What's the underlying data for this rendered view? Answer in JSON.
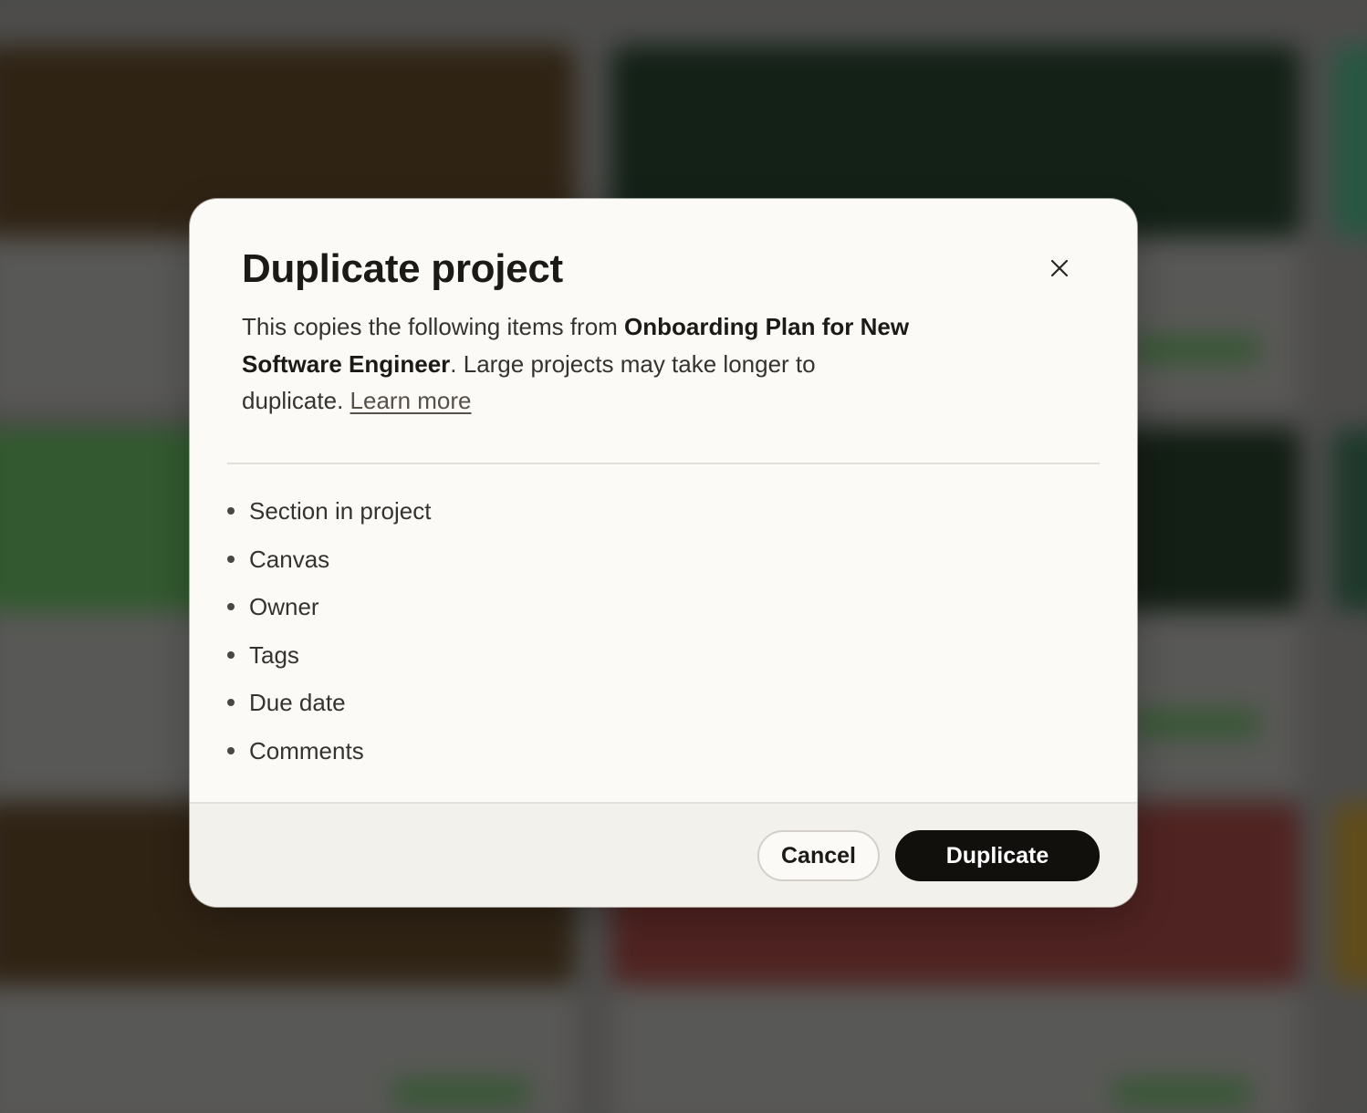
{
  "colors": {
    "modal_bg": "#fbfaf7",
    "footer_bg": "#f3f1ec",
    "primary_button": "#12100d",
    "text": "#1c1a17"
  },
  "dialog": {
    "title": "Duplicate project",
    "close_icon": "close-icon",
    "description": {
      "prefix": "This copies the following items from ",
      "project_name": "Onboarding Plan for New Software Engineer",
      "suffix": ". Large projects may take longer to duplicate. ",
      "link": "Learn more"
    },
    "items": [
      "Section in project",
      "Canvas",
      "Owner",
      "Tags",
      "Due date",
      "Comments"
    ],
    "buttons": {
      "cancel": "Cancel",
      "confirm": "Duplicate"
    }
  }
}
